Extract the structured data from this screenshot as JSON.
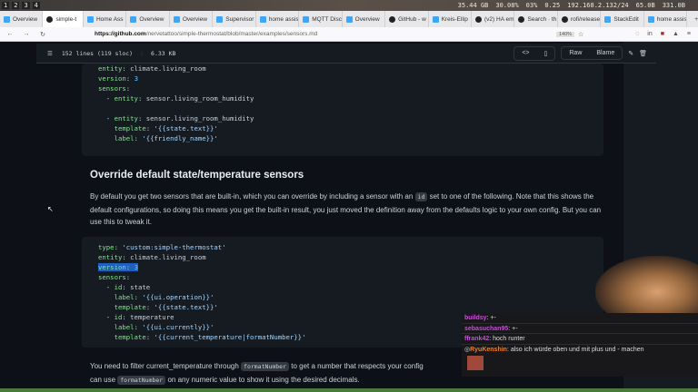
{
  "panel": {
    "workspaces": [
      "1",
      "2",
      "3",
      "4"
    ],
    "stats": [
      "35.44 GB",
      "30.08%",
      "03%",
      "0.25",
      "192.168.2.132/24",
      "65.0B",
      "331.0B"
    ]
  },
  "tabs": [
    {
      "label": "Overview"
    },
    {
      "label": "simple-t",
      "active": true
    },
    {
      "label": "Home Ass"
    },
    {
      "label": "Overview"
    },
    {
      "label": "Overview"
    },
    {
      "label": "Supervisor"
    },
    {
      "label": "home assis"
    },
    {
      "label": "MQTT Disc"
    },
    {
      "label": "Overview"
    },
    {
      "label": "GitHub - w"
    },
    {
      "label": "Kreis-Ellip"
    },
    {
      "label": "(v2) HA em"
    },
    {
      "label": "Search · th"
    },
    {
      "label": "rofi/release"
    },
    {
      "label": "StackEdit"
    },
    {
      "label": "home assis"
    }
  ],
  "nav": {
    "url_host": "https://github.com",
    "url_path": "/nervetattoo/simple-thermostat/blob/master/examples/sensors.md",
    "zoom": "140%"
  },
  "file": {
    "lines": "152 lines (119 sloc)",
    "size": "6.33 KB",
    "raw": "Raw",
    "blame": "Blame"
  },
  "heading": "Override default state/temperature sensors",
  "para1": {
    "a": "By default you get two sensors that are built-in, which you can override by including a sensor with an ",
    "code": "id",
    "b": " set to one of the following. Note that this shows the default configurations, so doing this means you get the built-in result, you just moved the definition away from the defaults logic to your own config. But you can use this to tweak it."
  },
  "para2": {
    "a": "You need to filter current_temperature through ",
    "code1": "formatNumber",
    "b": " to get a number that respects your config",
    "c": "can use ",
    "code2": "formatNumber",
    "d": " on any numeric value to show it using the desired decimals."
  },
  "chat": [
    {
      "user": "buildsy",
      "text": " +-"
    },
    {
      "user": "sebasuchan95",
      "text": " +-"
    },
    {
      "user": "ffrank42",
      "text": " hoch runter"
    },
    {
      "user": "RyuKenshin",
      "text": " also ich würde oben und mit plus und - machen"
    }
  ]
}
